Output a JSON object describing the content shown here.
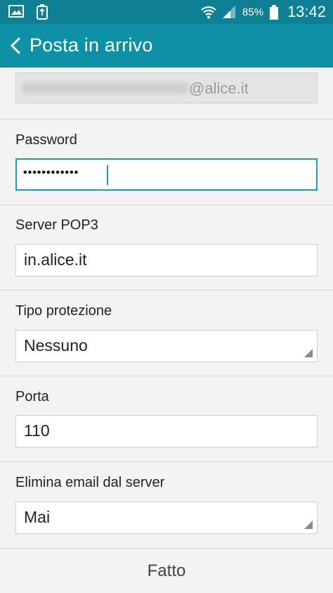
{
  "status_bar": {
    "battery_percent": "85%",
    "time": "13:42",
    "icons": [
      "image-icon",
      "usb-icon",
      "wifi-icon",
      "signal-icon",
      "battery-icon"
    ]
  },
  "header": {
    "title": "Posta in arrivo"
  },
  "form": {
    "email_domain": "@alice.it",
    "password_label": "Password",
    "password_value": "••••••••••••",
    "server_label": "Server POP3",
    "server_value": "in.alice.it",
    "security_label": "Tipo protezione",
    "security_value": "Nessuno",
    "port_label": "Porta",
    "port_value": "110",
    "delete_label": "Elimina email dal server",
    "delete_value": "Mai"
  },
  "footer": {
    "done_label": "Fatto"
  },
  "colors": {
    "status_bar": "#0f7f93",
    "action_bar": "#0e90a6",
    "focus": "#1a9cc0"
  }
}
